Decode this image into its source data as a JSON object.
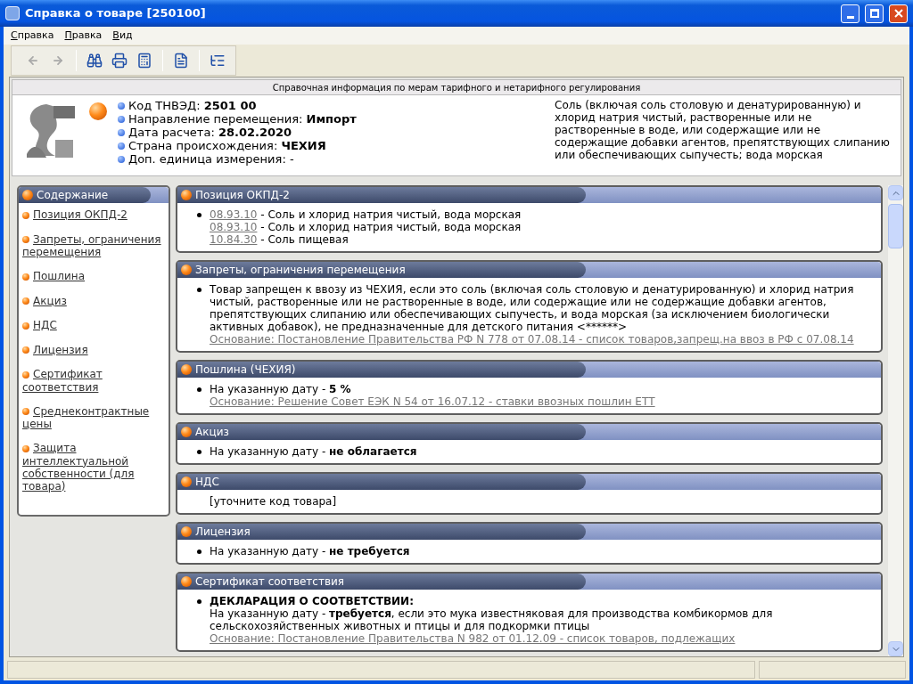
{
  "window": {
    "title": "Справка о товаре [250100]"
  },
  "menu": [
    "Справка",
    "Правка",
    "Вид"
  ],
  "toolbar": [
    {
      "kind": "back",
      "disabled": true
    },
    {
      "kind": "forward",
      "disabled": true
    },
    {
      "kind": "sep"
    },
    {
      "kind": "find",
      "disabled": false
    },
    {
      "kind": "print",
      "disabled": false
    },
    {
      "kind": "calc",
      "disabled": false
    },
    {
      "kind": "sep"
    },
    {
      "kind": "word",
      "disabled": false
    },
    {
      "kind": "sep"
    },
    {
      "kind": "tree",
      "disabled": false
    }
  ],
  "header": {
    "title": "Справочная информация по мерам тарифного и нетарифного регулирования",
    "facts": [
      "Код ТНВЭД: **2501 00**",
      "Направление перемещения: **Импорт**",
      "Дата расчета: **28.02.2020**",
      "Страна происхождения: **ЧЕХИЯ**",
      "Доп. единица измерения: -"
    ],
    "description": "Соль (включая соль столовую и денатурированную) и хлорид натрия чистый, растворенные или не растворенные в воде, или содержащие или не содержащие добавки агентов, препятствующих слипанию или обеспечивающих сыпучесть; вода морская"
  },
  "contents": {
    "title": "Содержание",
    "items": [
      "Позиция ОКПД-2",
      "Запреты, ограничения перемещения",
      "Пошлина",
      "Акциз",
      "НДС",
      "Лицензия",
      "Сертификат соответствия",
      "Среднеконтрактные цены",
      "Защита интеллектуальной собственности (для товара)"
    ]
  },
  "sections": [
    {
      "title": "Позиция ОКПД-2",
      "bullet": true,
      "lines": [
        {
          "kind": "code",
          "code": "08.93.10",
          "text": " - Соль и хлорид натрия чистый, вода морская"
        },
        {
          "kind": "code",
          "code": "08.93.10",
          "text": " - Соль и хлорид натрия чистый, вода морская"
        },
        {
          "kind": "code",
          "code": "10.84.30",
          "text": " - Соль пищевая"
        }
      ]
    },
    {
      "title": "Запреты, ограничения перемещения",
      "bullet": true,
      "lines": [
        {
          "kind": "text",
          "text": "Товар запрещен к ввозу из ЧЕХИЯ, если это соль (включая соль столовую и денатурированную) и хлорид натрия чистый, растворенные или не растворенные в воде, или содержащие или не содержащие добавки агентов, препятствующих слипанию или обеспечивающих сыпучесть, и вода морская (за исключением биологически активных добавок), не предназначенные для детского питания <******>"
        },
        {
          "kind": "basis",
          "text": "Основание: Постановление Правительства РФ N 778 от 07.08.14 - список товаров,запрещ.на ввоз в РФ с 07.08.14"
        }
      ]
    },
    {
      "title": "Пошлина (ЧЕХИЯ)",
      "bullet": true,
      "lines": [
        {
          "kind": "rich",
          "text": "На указанную дату - **5 %**"
        },
        {
          "kind": "basis",
          "text": "Основание: Решение Совет ЕЭК N 54 от 16.07.12 - ставки ввозных пошлин ЕТТ"
        }
      ]
    },
    {
      "title": "Акциз",
      "bullet": true,
      "lines": [
        {
          "kind": "rich",
          "text": "На указанную дату - **не облагается**"
        }
      ]
    },
    {
      "title": "НДС",
      "bullet": false,
      "lines": [
        {
          "kind": "text",
          "text": "[уточните код товара]"
        }
      ]
    },
    {
      "title": "Лицензия",
      "bullet": true,
      "lines": [
        {
          "kind": "rich",
          "text": "На указанную дату - **не требуется**"
        }
      ]
    },
    {
      "title": "Сертификат соответствия",
      "bullet": true,
      "lines": [
        {
          "kind": "heading",
          "text": "ДЕКЛАРАЦИЯ О СООТВЕТСТВИИ:"
        },
        {
          "kind": "rich",
          "text": "На указанную дату - **требуется**, если это мука известняковая для производства комбикормов для сельскохозяйственных животных и птицы и для подкормки птицы"
        },
        {
          "kind": "basis",
          "text": "Основание: Постановление Правительства N 982 от 01.12.09 - список товаров, подлежащих"
        }
      ]
    }
  ]
}
